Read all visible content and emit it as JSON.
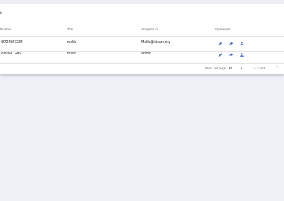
{
  "card": {
    "title": "s"
  },
  "table": {
    "columns": [
      "Number",
      "Title",
      "Assigned to",
      "Operations"
    ],
    "rows": [
      {
        "number": "48724987234",
        "title": "malik",
        "assigned_to": "Malik@icicare.org"
      },
      {
        "number": "3980681246",
        "title": "malik",
        "assigned_to": "admin"
      }
    ]
  },
  "paginator": {
    "items_per_page_label": "Items per page:",
    "items_per_page_value": "10",
    "range_label": "1 – 2 of 2"
  },
  "icons": {
    "edit": "edit-pencil-icon",
    "forward": "forward-arrow-icon",
    "assign": "person-icon",
    "accent": "#3f6fd8"
  }
}
